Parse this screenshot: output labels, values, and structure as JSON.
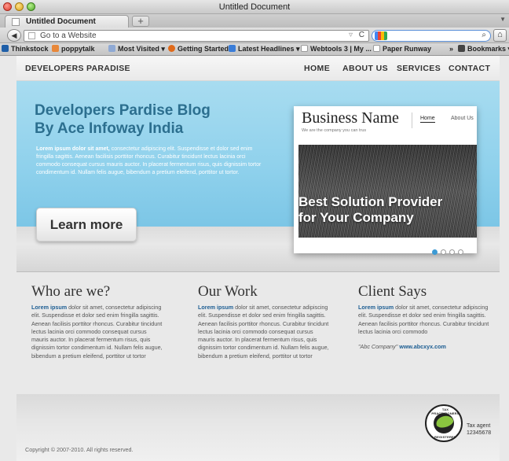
{
  "browser": {
    "window_title": "Untitled Document",
    "tab_label": "Untitled Document",
    "new_tab_label": "+",
    "url_placeholder": "Go to a Website",
    "search_value": "",
    "bookmarks": [
      "Thinkstock",
      "poppytalk",
      "Most Visited ▾",
      "Getting Started",
      "Latest Headlines ▾",
      "Webtools 3 | My ...",
      "Paper Runway"
    ],
    "bookmarks_more": "»",
    "bookmarks_menu": "Bookmarks ▾"
  },
  "site": {
    "brand": "DEVELOPERS PARADISE",
    "menu": [
      "HOME",
      "ABOUT US",
      "SERVICES",
      "CONTACT"
    ]
  },
  "hero": {
    "title_line1": "Developers Pardise Blog",
    "title_line2": "By Ace Infoway India",
    "text_lead": "Lorem ipsum dolor sit amet,",
    "text_body": " consectetur adipiscing elit. Suspendisse et dolor sed enim fringilla sagittis. Aenean facilisis porttitor rhoncus. Curabitur tincidunt lectus lacinia orci commodo consequat cursus mauris auctor. In placerat fermentum risus, quis dignissim tortor condimentum id. Nullam felis augue, bibendum a pretium eleifend, porttitor ut tortor.",
    "button_label": "Learn more"
  },
  "slider": {
    "business_name": "Business Name",
    "tagline": "We are the company you can trus",
    "nav_home": "Home",
    "nav_about": "About Us",
    "caption_line1": "Best Solution Provider",
    "caption_line2": "for Your Company",
    "slide_count": 4,
    "active_slide": 1
  },
  "columns": [
    {
      "title": "Who are we?",
      "lead": "Lorem ipsum",
      "text": " dolor sit amet, consectetur adipiscing elit. Suspendisse et dolor sed enim fringilla sagittis. Aenean facilisis porttitor rhoncus. Curabitur tincidunt lectus lacinia orci commodo consequat cursus mauris auctor. In placerat fermentum risus, quis dignissim tortor condimentum id. Nullam felis augue, bibendum a pretium eleifend, porttitor ut tortor"
    },
    {
      "title": "Our Work",
      "lead": "Lorem ipsum",
      "text": " dolor sit amet, consectetur adipiscing elit. Suspendisse et dolor sed enim fringilla sagittis. Aenean facilisis porttitor rhoncus. Curabitur tincidunt lectus lacinia orci commodo consequat cursus mauris auctor. In placerat fermentum risus, quis dignissim tortor condimentum id. Nullam felis augue, bibendum a pretium eleifend, porttitor ut tortor"
    },
    {
      "title": "Client Says",
      "lead": "Lorem ipsum",
      "text": " dolor sit amet, consectetur adipiscing elit. Suspendisse et dolor sed enim fringilla sagittis. Aenean facilisis porttitor rhoncus. Curabitur tincidunt lectus lacinia orci commodo",
      "quote_company": "\"Abc Company\"",
      "quote_url": "www.abcxyx.com"
    }
  ],
  "footer": {
    "copyright": "Copyright © 2007-2010. All rights reserved.",
    "seal_top": "TAX PRACTITIONERS BOARD",
    "seal_bottom": "REGISTERED",
    "tax_label_line1": "Tax agent",
    "tax_label_line2": "12345678"
  },
  "colors": {
    "hero_bg": "#8fd1ec",
    "hero_title": "#2c6f8f",
    "link_blue": "#1c5d92",
    "active_dot": "#3c9ad4",
    "seal_green": "#8ac43f"
  }
}
